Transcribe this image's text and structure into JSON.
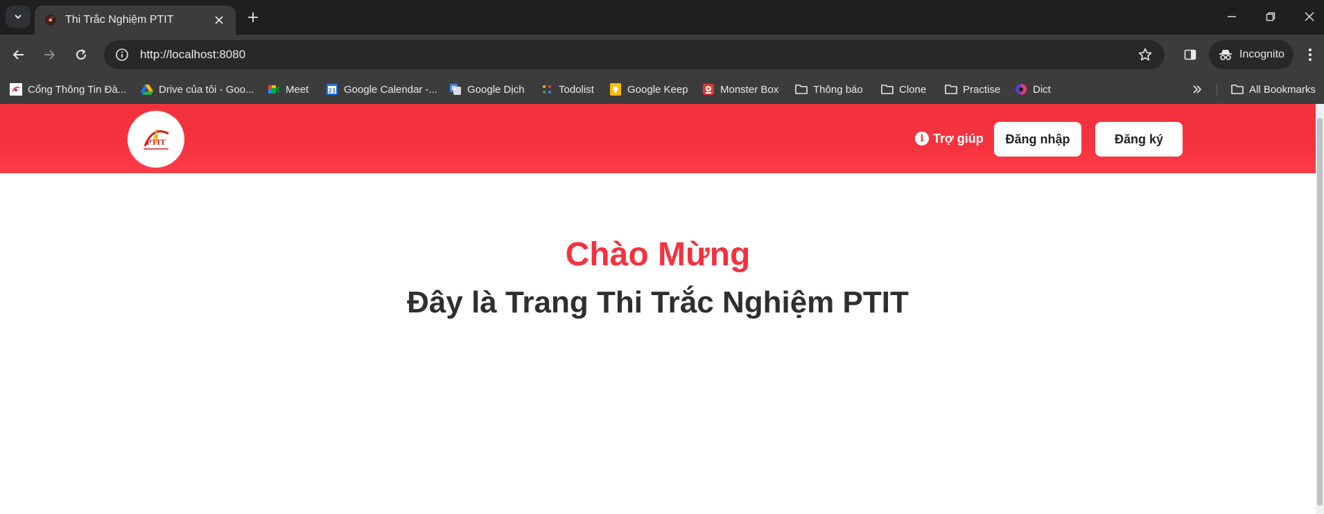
{
  "browser": {
    "tab": {
      "title": "Thi Trắc Nghiệm PTIT"
    },
    "address": {
      "url": "http://localhost:8080"
    },
    "incognito_label": "Incognito",
    "bookmarks": [
      {
        "label": "Cổng Thông Tin Đà...",
        "icon": "ptit-favicon"
      },
      {
        "label": "Drive của tôi - Goo...",
        "icon": "google-drive-icon"
      },
      {
        "label": "Meet",
        "icon": "google-meet-icon"
      },
      {
        "label": "Google Calendar -...",
        "icon": "google-calendar-icon"
      },
      {
        "label": "Google Dịch",
        "icon": "google-translate-icon"
      },
      {
        "label": "Todolist",
        "icon": "todolist-icon"
      },
      {
        "label": "Google Keep",
        "icon": "google-keep-icon"
      },
      {
        "label": "Monster Box",
        "icon": "monster-box-icon"
      },
      {
        "label": "Thông báo",
        "icon": "folder-icon"
      },
      {
        "label": "Clone",
        "icon": "folder-icon"
      },
      {
        "label": "Practise",
        "icon": "folder-icon"
      },
      {
        "label": "Dict",
        "icon": "dict-icon"
      }
    ],
    "all_bookmarks_label": "All Bookmarks"
  },
  "page": {
    "header": {
      "help_label": "Trợ giúp",
      "login_label": "Đăng nhập",
      "register_label": "Đăng ký",
      "logo_text": "PTIT"
    },
    "hero": {
      "title": "Chào Mừng",
      "subtitle": "Đây là Trang Thi Trắc Nghiệm PTIT"
    }
  },
  "colors": {
    "brand_red": "#f4323e",
    "chrome_dark": "#1f1f1f",
    "chrome_toolbar": "#3c3c3c"
  }
}
